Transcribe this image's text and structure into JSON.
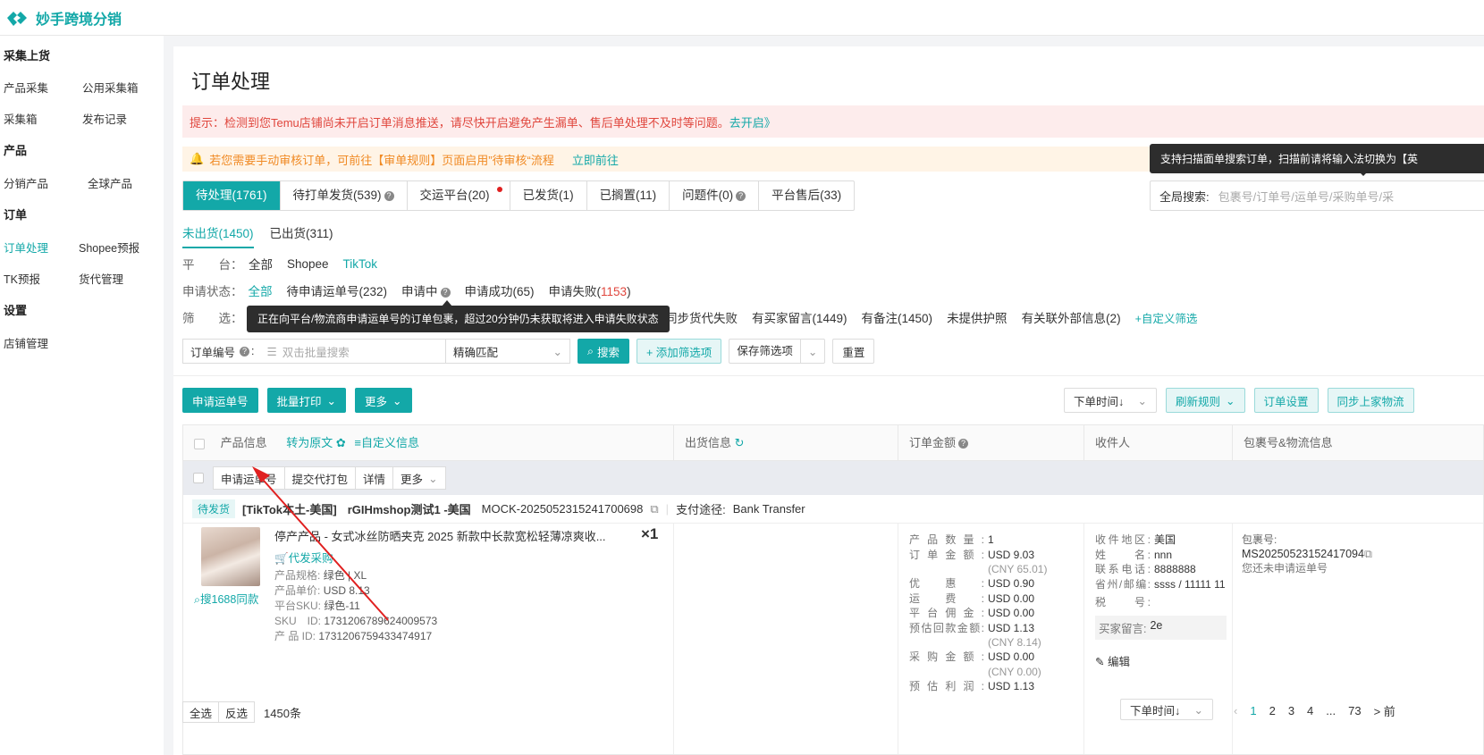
{
  "app": {
    "brand": "妙手跨境分销"
  },
  "sidebar": {
    "groups": [
      {
        "title": "采集上货",
        "items": [
          "产品采集",
          "公用采集箱",
          "采集箱",
          "发布记录"
        ]
      },
      {
        "title": "产品",
        "items": [
          "分销产品",
          "全球产品"
        ]
      },
      {
        "title": "订单",
        "items": [
          "订单处理",
          "Shopee预报",
          "TK预报",
          "货代管理"
        ]
      },
      {
        "title": "设置",
        "items": [
          "店铺管理"
        ]
      }
    ],
    "active": "订单处理"
  },
  "page": {
    "title": "订单处理",
    "alert_red": "提示：检测到您Temu店铺尚未开启订单消息推送，请尽快开启避免产生漏单、售后单处理不及时等问题。",
    "alert_red_link": "去开启》",
    "alert_orange": "若您需要手动审核订单，可前往【审单规则】页面启用”待审核“流程",
    "alert_orange_link": "立即前往",
    "tooltip_scan": "支持扫描面单搜索订单，扫描前请将输入法切换为【英",
    "tabs": [
      "待处理(1761)",
      "待打单发货(539)",
      "交运平台(20)",
      "已发货(1)",
      "已搁置(11)",
      "问题件(0)",
      "平台售后(33)"
    ],
    "global_search_label": "全局搜索:",
    "global_search_placeholder": "包裹号/订单号/运单号/采购单号/采",
    "subtabs": [
      "未出货(1450)",
      "已出货(311)"
    ],
    "platform_label": "平　　台：",
    "platform_options": [
      "全部",
      "Shopee",
      "TikTok"
    ],
    "status_label": "申请状态：",
    "status_options": {
      "all": "全部",
      "pending": "待申请运单号(232)",
      "applying": "申请中",
      "success": "申请成功(65)",
      "failed_prefix": "申请失败(",
      "failed_count": "1153",
      "failed_suffix": ")"
    },
    "filter_label": "筛　　选：",
    "filter_options": [
      "同步货代失败",
      "有买家留言(1449)",
      "有备注(1450)",
      "未提供护照",
      "有关联外部信息(2)"
    ],
    "filter_custom": "+自定义筛选",
    "tooltip_applying": "正在向平台/物流商申请运单号的订单包裹，超过20分钟仍未获取将进入申请失败状态",
    "order_no_label": "订单编号",
    "batch_search_placeholder": "双击批量搜索",
    "match_mode": "精确匹配",
    "search_btn": "搜索",
    "add_filter_btn": "+ 添加筛选项",
    "save_filter_btn": "保存筛选项",
    "reset_btn": "重置",
    "actions": {
      "apply": "申请运单号",
      "batch_print": "批量打印",
      "more": "更多"
    },
    "right_actions": {
      "sort": "下单时间↓",
      "refresh_rule": "刷新规则",
      "order_settings": "订单设置",
      "sync_logistics": "同步上家物流"
    },
    "table": {
      "headers": {
        "product": "产品信息",
        "to_original": "转为原文",
        "custom_info": "自定义信息",
        "shipping": "出货信息",
        "amount": "订单金额",
        "receiver": "收件人",
        "package": "包裹号&物流信息"
      },
      "bulk": [
        "申请运单号",
        "提交代打包",
        "详情",
        "更多"
      ]
    },
    "order": {
      "status": "待发货",
      "store": "[TikTok本土-美国]",
      "shop": "rGIHmshop测试1 -美国",
      "order_no": "MOCK-2025052315241700698",
      "payment_label": "支付途径:",
      "payment": "Bank Transfer",
      "product_title": "停产产品 - 女式冰丝防晒夹克 2025 新款中长款宽松轻薄凉爽收...",
      "quantity": "×1",
      "agent_purchase": "代发采购",
      "search_1688": "搜1688同款",
      "spec": [
        {
          "k": "产品规格:",
          "v": "绿色 | XL"
        },
        {
          "k": "产品单价:",
          "v": "USD 8.13"
        },
        {
          "k": "平台SKU:",
          "v": "绿色-11"
        },
        {
          "k": "SKU　ID:",
          "v": "1731206789624009573"
        },
        {
          "k": "产 品 ID:",
          "v": "1731206759433474917"
        }
      ],
      "amount": [
        {
          "k": "产品数量:",
          "v": "1",
          "sub": ""
        },
        {
          "k": "订单金额:",
          "v": "USD 9.03",
          "sub": "(CNY 65.01)"
        },
        {
          "k": "优惠:",
          "v": "USD 0.90",
          "sub": ""
        },
        {
          "k": "运费:",
          "v": "USD 0.00",
          "sub": ""
        },
        {
          "k": "平台佣金:",
          "v": "USD 0.00",
          "sub": ""
        },
        {
          "k": "预估回款金额:",
          "v": "USD 1.13",
          "sub": "(CNY 8.14)"
        },
        {
          "k": "采购金额:",
          "v": "USD 0.00",
          "sub": "(CNY 0.00)"
        },
        {
          "k": "预估利润:",
          "v": "USD 1.13",
          "sub": ""
        }
      ],
      "receiver": [
        {
          "k": "收件地区:",
          "v": "美国"
        },
        {
          "k": "姓　　名:",
          "v": "nnn"
        },
        {
          "k": "联系电话:",
          "v": "8888888"
        },
        {
          "k": "省州/邮编:",
          "v": "ssss / 11111 11"
        },
        {
          "k": "税　　号:",
          "v": ""
        }
      ],
      "buyer_msg_label": "买家留言:",
      "buyer_msg": "2e",
      "edit": "编辑",
      "package_label": "包裹号:",
      "package_no": "MS20250523152417094",
      "package_status": "您还未申请运单号"
    },
    "footer": {
      "select_all": "全选",
      "invert": "反选",
      "count": "1450条",
      "sort": "下单时间↓",
      "pages": [
        "1",
        "2",
        "3",
        "4",
        "...",
        "73"
      ],
      "next": "> 前"
    }
  }
}
